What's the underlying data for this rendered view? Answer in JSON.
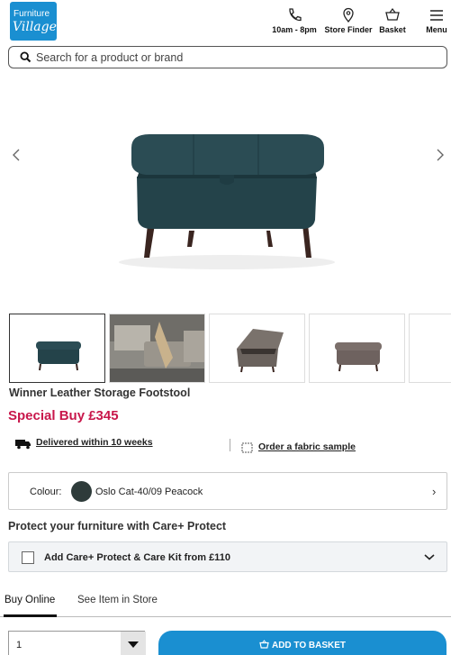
{
  "header": {
    "logo_line1": "Furniture",
    "logo_line2": "Village",
    "hours_label": "10am - 8pm",
    "store_label": "Store Finder",
    "basket_label": "Basket",
    "menu_label": "Menu"
  },
  "search": {
    "placeholder": "Search for a product or brand"
  },
  "gallery": {
    "thumbnail_count": 5,
    "active_index": 0
  },
  "product": {
    "title": "Winner Leather Storage Footstool",
    "price": "Special Buy £345",
    "delivery": "Delivered within 10 weeks",
    "fabric_sample": "Order a fabric sample"
  },
  "colour": {
    "label": "Colour:",
    "name": "Oslo Cat-40/09 Peacock",
    "swatch_hex": "#2e3b3a",
    "chevron": "›"
  },
  "protect": {
    "title": "Protect your furniture with Care+ Protect",
    "option": "Add Care+ Protect & Care Kit from £110"
  },
  "tabs": [
    {
      "label": "Buy Online",
      "active": true
    },
    {
      "label": "See Item in Store",
      "active": false
    }
  ],
  "purchase": {
    "quantity": "1",
    "add_label": "ADD TO BASKET"
  },
  "colors": {
    "brand_blue": "#1a8fd1",
    "price_red": "#c8174b",
    "product_teal": "#24434a"
  }
}
